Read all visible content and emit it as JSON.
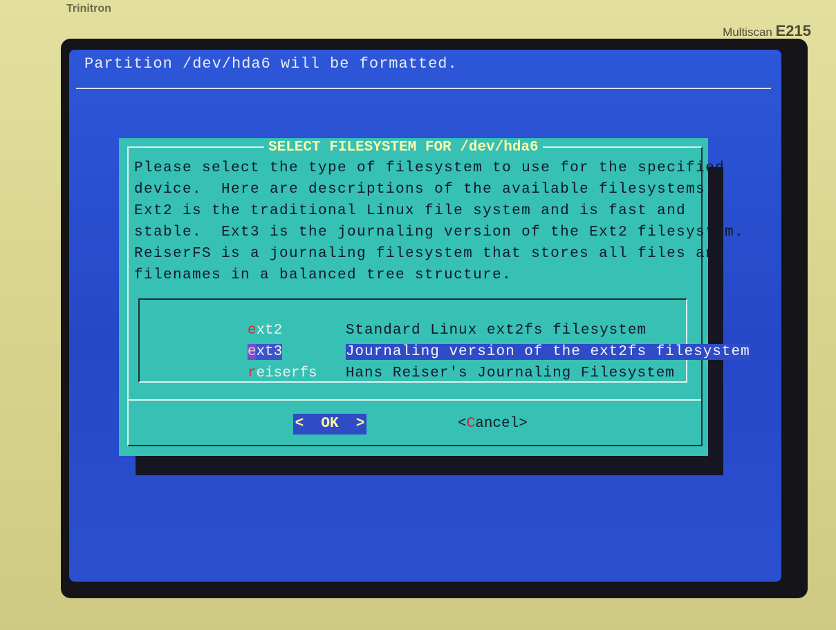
{
  "monitor": {
    "brand": "Trinitron",
    "model_prefix": "Multiscan",
    "model_code": "E215"
  },
  "screen": {
    "header_text": "Partition /dev/hda6 will be formatted."
  },
  "dialog": {
    "title": "SELECT FILESYSTEM FOR /dev/hda6",
    "description": "Please select the type of filesystem to use for the specified\ndevice.  Here are descriptions of the available filesystems:\nExt2 is the traditional Linux file system and is fast and\nstable.  Ext3 is the journaling version of the Ext2 filesystem.\nReiserFS is a journaling filesystem that stores all files and\nfilenames in a balanced tree structure.",
    "options": [
      {
        "tag_hot": "e",
        "tag_rest": "xt2",
        "item": "Standard Linux ext2fs filesystem",
        "selected": false
      },
      {
        "tag_hot": "e",
        "tag_rest": "xt3",
        "item": "Journaling version of the ext2fs filesystem",
        "selected": true
      },
      {
        "tag_hot": "r",
        "tag_rest": "eiserfs",
        "item": "Hans Reiser's Journaling Filesystem",
        "selected": false
      }
    ],
    "ok_label": "<  OK  >",
    "cancel_open": "<",
    "cancel_hot": "C",
    "cancel_rest": "ancel>"
  },
  "colors": {
    "screen_bg": "#2a4fcf",
    "dialog_bg": "#37c0b4",
    "title_fg": "#fff7a8",
    "selection_bg": "#2f4cc6",
    "hotkey_fg": "#d42a44"
  }
}
